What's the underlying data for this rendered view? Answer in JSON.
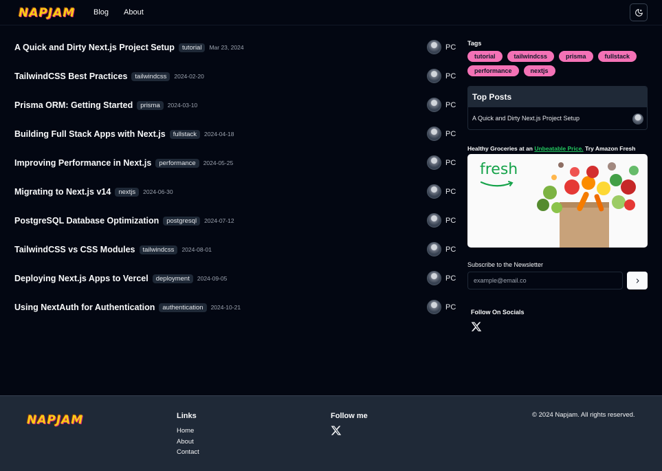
{
  "header": {
    "logo": "NAPJAM",
    "nav": [
      {
        "label": "Blog"
      },
      {
        "label": "About"
      }
    ],
    "theme_icon": "moon-icon"
  },
  "posts": [
    {
      "title": "A Quick and Dirty Next.js Project Setup",
      "tag": "tutorial",
      "date": "Mar 23, 2024",
      "author": "PC"
    },
    {
      "title": "TailwindCSS Best Practices",
      "tag": "tailwindcss",
      "date": "2024-02-20",
      "author": "PC"
    },
    {
      "title": "Prisma ORM: Getting Started",
      "tag": "prisma",
      "date": "2024-03-10",
      "author": "PC"
    },
    {
      "title": "Building Full Stack Apps with Next.js",
      "tag": "fullstack",
      "date": "2024-04-18",
      "author": "PC"
    },
    {
      "title": "Improving Performance in Next.js",
      "tag": "performance",
      "date": "2024-05-25",
      "author": "PC"
    },
    {
      "title": "Migrating to Next.js v14",
      "tag": "nextjs",
      "date": "2024-06-30",
      "author": "PC"
    },
    {
      "title": "PostgreSQL Database Optimization",
      "tag": "postgresql",
      "date": "2024-07-12",
      "author": "PC"
    },
    {
      "title": "TailwindCSS vs CSS Modules",
      "tag": "tailwindcss",
      "date": "2024-08-01",
      "author": "PC"
    },
    {
      "title": "Deploying Next.js Apps to Vercel",
      "tag": "deployment",
      "date": "2024-09-05",
      "author": "PC"
    },
    {
      "title": "Using NextAuth for Authentication",
      "tag": "authentication",
      "date": "2024-10-21",
      "author": "PC"
    }
  ],
  "sidebar": {
    "tags_heading": "Tags",
    "tags": [
      "tutorial",
      "tailwindcss",
      "prisma",
      "fullstack",
      "performance",
      "nextjs"
    ],
    "top_posts_heading": "Top Posts",
    "top_posts": [
      {
        "title": "A Quick and Dirty Next.js Project Setup"
      }
    ],
    "ad": {
      "text_before": "Healthy Groceries at an ",
      "highlight": "Unbeatable Price.",
      "text_after": " Try Amazon Fresh",
      "image_word": "fresh"
    },
    "newsletter": {
      "label": "Subscribe to the Newsletter",
      "placeholder": "example@email.co",
      "submit_icon": "chevron-right-icon"
    },
    "socials_heading": "Follow On Socials",
    "social_icon": "x-icon"
  },
  "footer": {
    "logo": "NAPJAM",
    "links_heading": "Links",
    "links": [
      "Home",
      "About",
      "Contact"
    ],
    "follow_heading": "Follow me",
    "copyright": "© 2024 Napjam. All rights reserved."
  },
  "colors": {
    "background": "#030712",
    "footer_bg": "#1f2937",
    "tag_pill": "#f472b6",
    "accent_green": "#22c55e",
    "logo_yellow": "#facc15"
  }
}
